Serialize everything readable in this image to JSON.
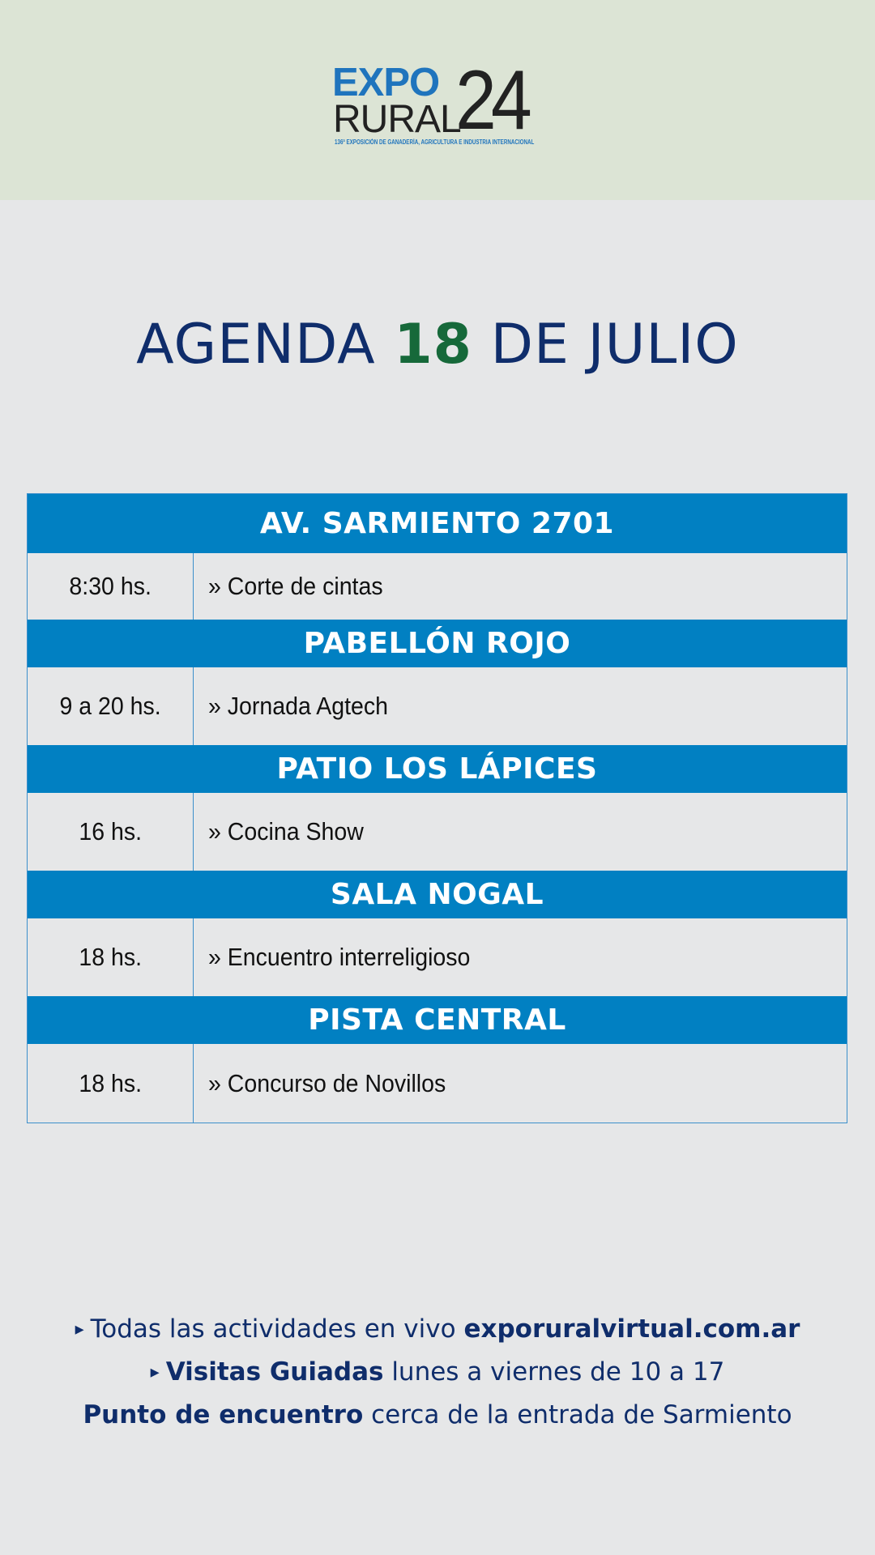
{
  "header": {
    "logo": {
      "expo": "EXPO",
      "rural": "RURAL",
      "year": "24",
      "tagline": "136ª EXPOSICIÓN DE GANADERÍA, AGRICULTURA E INDUSTRIA INTERNACIONAL"
    },
    "colors": {
      "background": "#dce4d5",
      "brand_blue": "#1f74bd"
    }
  },
  "title": {
    "prefix": "AGENDA ",
    "day": "18",
    "suffix": " DE JULIO"
  },
  "agenda": [
    {
      "venue": "AV. SARMIENTO 2701",
      "time": "8:30 hs.",
      "event": "» Corte de cintas"
    },
    {
      "venue": "PABELLÓN ROJO",
      "time": "9 a 20 hs.",
      "event": "» Jornada Agtech"
    },
    {
      "venue": "PATIO LOS LÁPICES",
      "time": "16 hs.",
      "event": "» Cocina Show"
    },
    {
      "venue": "SALA NOGAL",
      "time": "18 hs.",
      "event": "» Encuentro interreligioso"
    },
    {
      "venue": "PISTA CENTRAL",
      "time": "18 hs.",
      "event": "» Concurso de Novillos"
    }
  ],
  "footer": {
    "line1_bullet": "▸",
    "line1_text": "Todas las actividades en vivo ",
    "line1_link": "exporuralvirtual.com.ar",
    "line2_bullet": "▸",
    "line2_bold": "Visitas Guiadas",
    "line2_text": " lunes a viernes de 10 a 17",
    "line3_bold": "Punto de encuentro",
    "line3_text": " cerca de la entrada de Sarmiento"
  },
  "colors": {
    "venue_bar": "#0180c2",
    "title_blue": "#0f2d6b",
    "title_green": "#16693a",
    "page_background": "#e6e7e8"
  }
}
